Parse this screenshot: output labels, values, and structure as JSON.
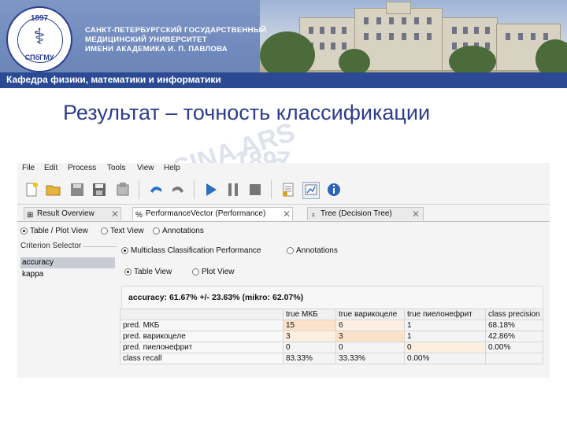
{
  "banner": {
    "logo_year": "1897",
    "logo_abbr": "СПбГМУ",
    "university_lines": [
      "САНКТ-ПЕТЕРБУРГСКИЙ ГОСУДАРСТВЕННЫЙ",
      "МЕДИЦИНСКИЙ УНИВЕРСИТЕТ",
      "ИМЕНИ АКАДЕМИКА И. П. ПАВЛОВА"
    ],
    "department": "Кафедра физики, математики и информатики"
  },
  "slide": {
    "title": "Результат – точность классификации"
  },
  "watermark": {
    "line1": "SINA ARS NOBILIS",
    "line2": "1897"
  },
  "app": {
    "menu": [
      "File",
      "Edit",
      "Process",
      "Tools",
      "View",
      "Help"
    ],
    "toolbar_icons": [
      "new-process-icon",
      "open-icon",
      "save-icon",
      "save-as-icon",
      "export-icon",
      "undo-icon",
      "redo-icon",
      "run-icon",
      "pause-icon",
      "stop-icon",
      "report-icon",
      "perspective-icon",
      "info-icon"
    ],
    "tabs": [
      {
        "label": "Result Overview",
        "icon": "⊞",
        "active": false
      },
      {
        "label": "PerformanceVector (Performance)",
        "icon": "%",
        "active": true
      },
      {
        "label": "Tree (Decision Tree)",
        "icon": "♁",
        "active": false
      }
    ],
    "view_options": [
      {
        "label": "Table / Plot View",
        "selected": true
      },
      {
        "label": "Text View",
        "selected": false
      },
      {
        "label": "Annotations",
        "selected": false
      }
    ],
    "criterion_selector": {
      "label": "Criterion Selector",
      "items": [
        {
          "label": "accuracy",
          "selected": true
        },
        {
          "label": "kappa",
          "selected": false
        }
      ]
    },
    "perf_options": [
      {
        "label": "Multiclass Classification Performance",
        "selected": true
      },
      {
        "label": "Annotations",
        "selected": false
      }
    ],
    "display_options": [
      {
        "label": "Table View",
        "selected": true
      },
      {
        "label": "Plot View",
        "selected": false
      }
    ],
    "accuracy_text": "accuracy: 61.67% +/- 23.63% (mikro: 62.07%)",
    "table": {
      "columns": [
        "",
        "true МКБ",
        "true варикоцеле",
        "true пиелонефрит",
        "class precision"
      ],
      "rows": [
        [
          "pred. МКБ",
          "15",
          "6",
          "1",
          "68.18%"
        ],
        [
          "pred. варикоцеле",
          "3",
          "3",
          "1",
          "42.86%"
        ],
        [
          "pred. пиелонефрит",
          "0",
          "0",
          "0",
          "0.00%"
        ],
        [
          "class recall",
          "83.33%",
          "33.33%",
          "0.00%",
          ""
        ]
      ]
    }
  },
  "colors": {
    "title": "#2d3d8f",
    "department_bar": "#2b4a93",
    "diag_cell": "#fbe2c8"
  }
}
